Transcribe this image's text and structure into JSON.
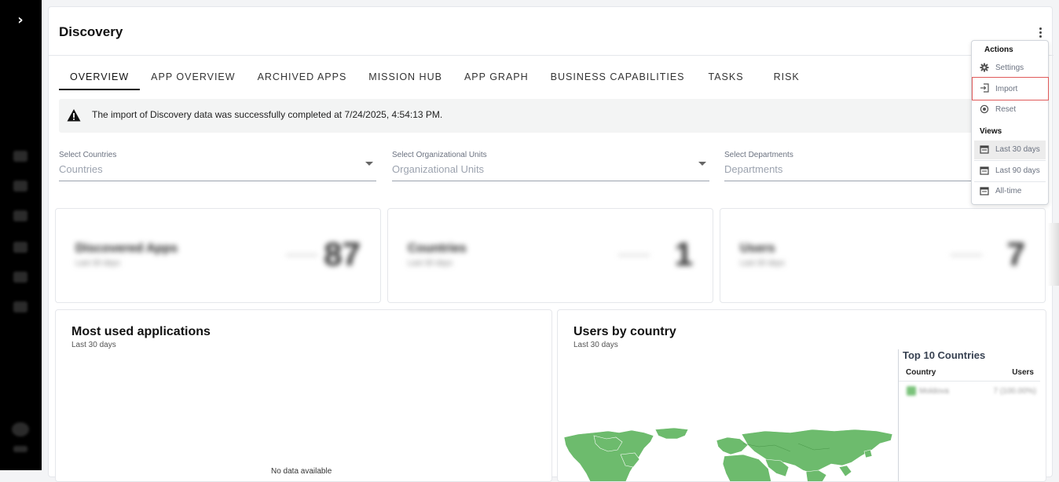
{
  "page": {
    "title": "Discovery"
  },
  "tabs": [
    {
      "label": "OVERVIEW"
    },
    {
      "label": "APP OVERVIEW"
    },
    {
      "label": "ARCHIVED APPS"
    },
    {
      "label": "MISSION HUB"
    },
    {
      "label": "APP GRAPH"
    },
    {
      "label": "BUSINESS CAPABILITIES"
    },
    {
      "label": "TASKS"
    },
    {
      "label": "RISK"
    }
  ],
  "alert": {
    "message": "The import of Discovery data was successfully completed at 7/24/2025, 4:54:13 PM."
  },
  "filters": {
    "countries": {
      "label": "Select Countries",
      "placeholder": "Countries"
    },
    "org_units": {
      "label": "Select Organizational Units",
      "placeholder": "Organizational Units"
    },
    "departments": {
      "label": "Select Departments",
      "placeholder": "Departments"
    }
  },
  "stats": [
    {
      "name": "Discovered Apps",
      "sub": "Last 30 days",
      "value": "87"
    },
    {
      "name": "Countries",
      "sub": "Last 30 days",
      "value": "1"
    },
    {
      "name": "Users",
      "sub": "Last 30 days",
      "value": "7"
    }
  ],
  "most_used": {
    "title": "Most used applications",
    "subtitle": "Last 30 days",
    "empty_text": "No data available"
  },
  "users_by_country": {
    "title": "Users by country",
    "subtitle": "Last 30 days",
    "top10_title": "Top 10 Countries",
    "col_country": "Country",
    "col_users": "Users",
    "row": {
      "country": "Moldova",
      "users": "7 (100.00%)"
    }
  },
  "actions_menu": {
    "actions_header": "Actions",
    "settings": "Settings",
    "import": "Import",
    "reset": "Reset",
    "views_header": "Views",
    "last30": "Last 30 days",
    "last90": "Last 90 days",
    "alltime": "All-time"
  },
  "colors": {
    "map_land": "#6dbb6d",
    "highlight_outline": "#e05a5a",
    "rail_bg": "#000000"
  }
}
